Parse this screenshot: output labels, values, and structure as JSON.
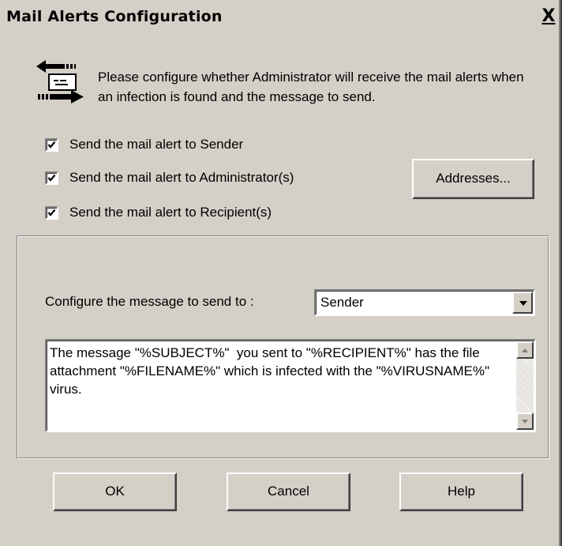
{
  "window": {
    "title": "Mail Alerts Configuration",
    "close_label": "X"
  },
  "intro": {
    "icon": "mail-arrows-icon",
    "text": "Please configure whether Administrator  will receive the mail alerts when an infection is found and the message to send."
  },
  "options": [
    {
      "label": "Send the mail alert to Sender",
      "checked": true
    },
    {
      "label": "Send the mail alert to Administrator(s)",
      "checked": true
    },
    {
      "label": "Send the mail alert to Recipient(s)",
      "checked": true
    }
  ],
  "addresses_button": "Addresses...",
  "message": {
    "configure_label": "Configure the message to send to :",
    "selected": "Sender",
    "body": "The message \"%SUBJECT%\"  you sent to \"%RECIPIENT%\" has the file attachment \"%FILENAME%\" which is infected with the \"%VIRUSNAME%\" virus."
  },
  "buttons": {
    "ok": "OK",
    "cancel": "Cancel",
    "help": "Help"
  },
  "colors": {
    "face": "#d4d0c8",
    "shadow": "#808080",
    "highlight": "#ffffff"
  }
}
